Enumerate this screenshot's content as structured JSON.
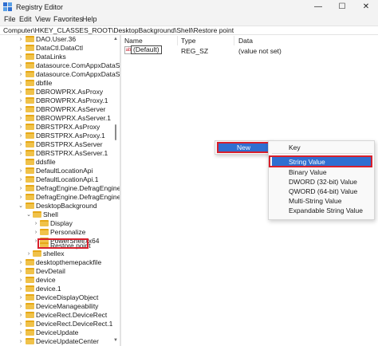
{
  "window": {
    "title": "Registry Editor",
    "controls": {
      "minimize": "—",
      "maximize": "☐",
      "close": "✕"
    }
  },
  "menu": [
    "File",
    "Edit",
    "View",
    "Favorites",
    "Help"
  ],
  "address": "Computer\\HKEY_CLASSES_ROOT\\DesktopBackground\\Shell\\Restore point",
  "tree": [
    {
      "label": "DAO.User.36",
      "expander": "›"
    },
    {
      "label": "DataCtl.DataCtl",
      "expander": "›"
    },
    {
      "label": "DataLinks",
      "expander": "›"
    },
    {
      "label": "datasource.ComAppxDataSou",
      "expander": "›"
    },
    {
      "label": "datasource.ComAppxDataSou",
      "expander": "›"
    },
    {
      "label": "dbfile",
      "expander": "›"
    },
    {
      "label": "DBROWPRX.AsProxy",
      "expander": "›"
    },
    {
      "label": "DBROWPRX.AsProxy.1",
      "expander": "›"
    },
    {
      "label": "DBROWPRX.AsServer",
      "expander": "›"
    },
    {
      "label": "DBROWPRX.AsServer.1",
      "expander": "›"
    },
    {
      "label": "DBRSTPRX.AsProxy",
      "expander": "›"
    },
    {
      "label": "DBRSTPRX.AsProxy.1",
      "expander": "›"
    },
    {
      "label": "DBRSTPRX.AsServer",
      "expander": "›"
    },
    {
      "label": "DBRSTPRX.AsServer.1",
      "expander": "›"
    },
    {
      "label": "ddsfile",
      "expander": ""
    },
    {
      "label": "DefaultLocationApi",
      "expander": "›"
    },
    {
      "label": "DefaultLocationApi.1",
      "expander": "›"
    },
    {
      "label": "DefragEngine.DefragEngine",
      "expander": "›"
    },
    {
      "label": "DefragEngine.DefragEngine.1",
      "expander": "›"
    },
    {
      "label": "DesktopBackground",
      "expander": "⌄"
    },
    {
      "label": "Shell",
      "expander": "⌄"
    },
    {
      "label": "Display",
      "expander": "›"
    },
    {
      "label": "Personalize",
      "expander": "›"
    },
    {
      "label": "PowerShell7x64",
      "expander": "›"
    },
    {
      "label": "Restore point",
      "expander": ""
    },
    {
      "label": "shellex",
      "expander": "›"
    },
    {
      "label": "desktopthemepackfile",
      "expander": "›"
    },
    {
      "label": "DevDetail",
      "expander": "›"
    },
    {
      "label": "device",
      "expander": "›"
    },
    {
      "label": "device.1",
      "expander": "›"
    },
    {
      "label": "DeviceDisplayObject",
      "expander": "›"
    },
    {
      "label": "DeviceManageability",
      "expander": "›"
    },
    {
      "label": "DeviceRect.DeviceRect",
      "expander": "›"
    },
    {
      "label": "DeviceRect.DeviceRect.1",
      "expander": "›"
    },
    {
      "label": "DeviceUpdate",
      "expander": "›"
    },
    {
      "label": "DeviceUpdateCenter",
      "expander": "›"
    }
  ],
  "list": {
    "columns": [
      "Name",
      "Type",
      "Data"
    ],
    "rows": [
      {
        "name": "(Default)",
        "type": "REG_SZ",
        "data": "(value not set)",
        "icon": "ab"
      }
    ]
  },
  "context_menu": {
    "new": "New",
    "arrow": "›"
  },
  "submenu": {
    "key": "Key",
    "items": [
      "String Value",
      "Binary Value",
      "DWORD (32-bit) Value",
      "QWORD (64-bit) Value",
      "Multi-String Value",
      "Expandable String Value"
    ]
  },
  "colors": {
    "highlight": "#d8202c",
    "selection": "#2f6fd1",
    "folder": "#f0c24a"
  }
}
